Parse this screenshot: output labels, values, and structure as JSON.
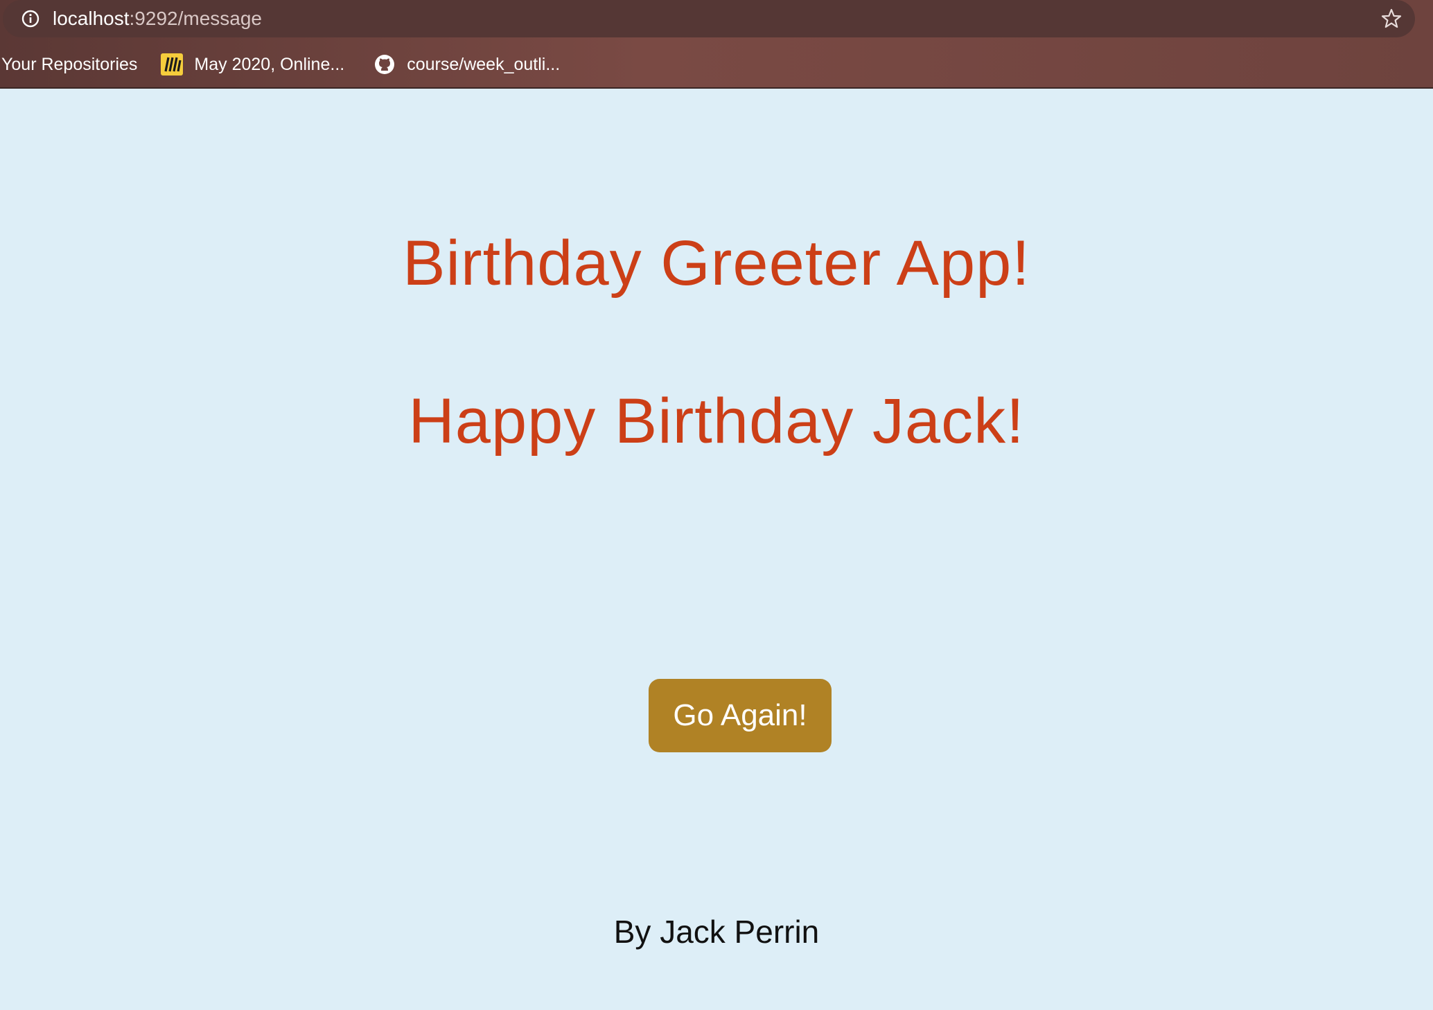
{
  "browser": {
    "url_host": "localhost",
    "url_path": ":9292/message",
    "bookmarks": [
      {
        "label": "Your Repositories",
        "icon": "none"
      },
      {
        "label": "May 2020, Online...",
        "icon": "miro-icon"
      },
      {
        "label": "course/week_outli...",
        "icon": "github-icon"
      }
    ]
  },
  "page": {
    "title": "Birthday Greeter App!",
    "greeting": "Happy Birthday Jack!",
    "button_label": "Go Again!",
    "byline": "By Jack Perrin"
  },
  "colors": {
    "background": "#ddeef7",
    "heading": "#cc3f17",
    "button": "#b08225",
    "chrome": "#6e433e"
  }
}
